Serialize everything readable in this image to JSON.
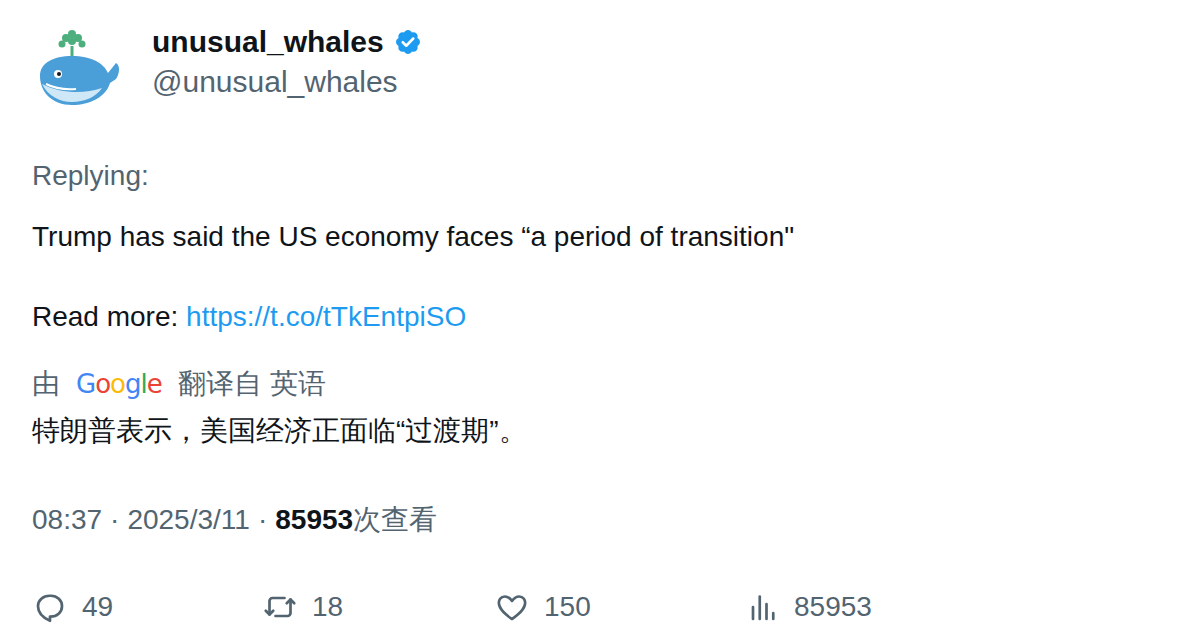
{
  "author": {
    "name": "unusual_whales",
    "handle": "@unusual_whales",
    "verified": true
  },
  "replying_label": "Replying:",
  "body": "Trump has said the US economy faces “a period of transition\"",
  "read_more": {
    "label": "Read more:",
    "link": "https://t.co/tTkEntpiSO"
  },
  "translation": {
    "prefix": "由",
    "brand": "Google",
    "suffix": "翻译自 英语",
    "text": "特朗普表示，美国经济正面临“过渡期”。"
  },
  "meta": {
    "time": "08:37",
    "separator": "·",
    "date": "2025/3/11",
    "views": "85953",
    "views_label": "次查看"
  },
  "actions": [
    {
      "kind": "reply",
      "count": "49"
    },
    {
      "kind": "retweet",
      "count": "18"
    },
    {
      "kind": "like",
      "count": "150"
    },
    {
      "kind": "views",
      "count": "85953"
    }
  ]
}
